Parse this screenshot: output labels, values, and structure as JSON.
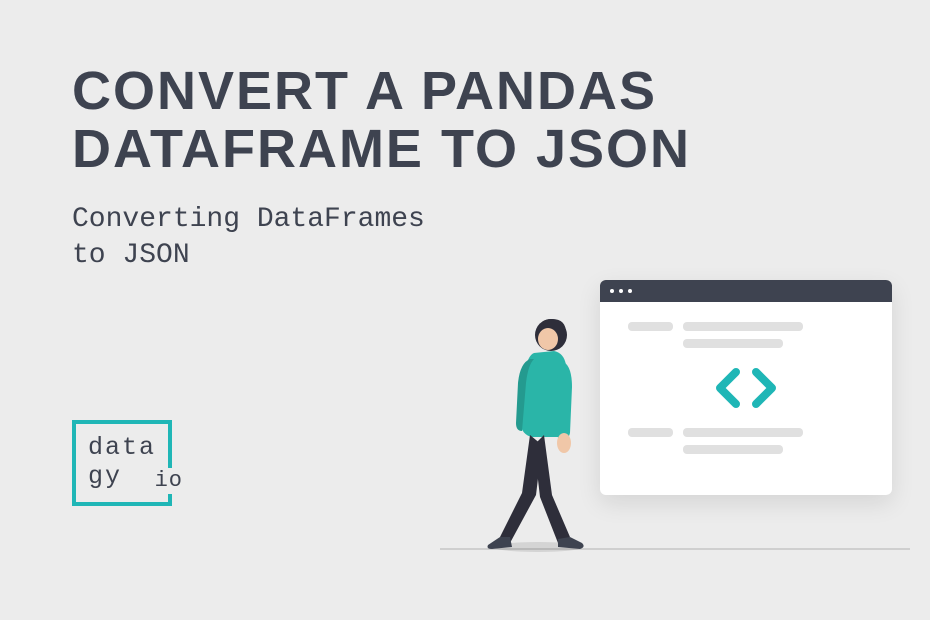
{
  "title": "CONVERT A PANDAS DATAFRAME TO JSON",
  "subtitle_line1": "Converting DataFrames",
  "subtitle_line2": "to JSON",
  "logo": {
    "line1": "data",
    "line2": "gy",
    "suffix": "io"
  },
  "colors": {
    "accent": "#1fb6b6",
    "text": "#3e4350",
    "background": "#ececec"
  },
  "icons": {
    "code_bracket_left": "code-bracket-left-icon",
    "code_bracket_right": "code-bracket-right-icon",
    "person": "walking-person-icon",
    "browser": "browser-window-icon"
  }
}
